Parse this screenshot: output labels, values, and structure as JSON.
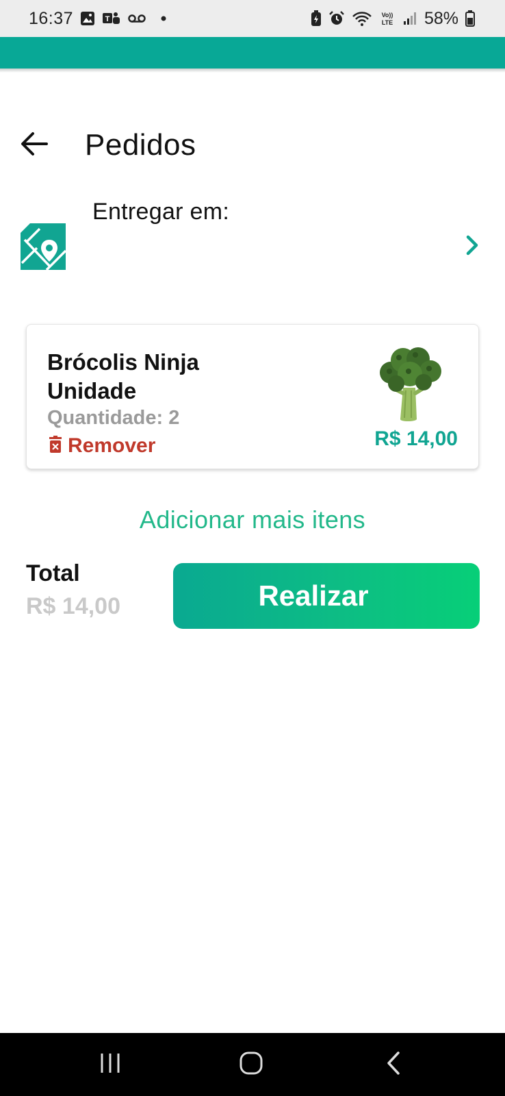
{
  "status_bar": {
    "time": "16:37",
    "battery_percent": "58%",
    "left_icons": [
      "gallery-icon",
      "teams-icon",
      "voicemail-icon",
      "dot-icon"
    ],
    "right_icons": [
      "battery-saver-icon",
      "alarm-icon",
      "wifi-icon",
      "volte-icon",
      "signal-icon",
      "battery-icon"
    ],
    "volte_text": "Vo)) LTE"
  },
  "colors": {
    "accent": "#08a896",
    "price": "#11a592",
    "remove": "#c0392b",
    "add_more": "#22b88a",
    "muted": "#9a9a9a",
    "button_gradient_start": "#0aa991",
    "button_gradient_end": "#07cf78"
  },
  "header": {
    "back_icon": "arrow-left-icon",
    "title": "Pedidos"
  },
  "delivery": {
    "icon": "map-pin-icon",
    "label": "Entregar em:",
    "chevron_icon": "chevron-right-icon"
  },
  "items": [
    {
      "name": "Brócolis Ninja Unidade",
      "quantity_text": "Quantidade: 2",
      "remove_label": "Remover",
      "remove_icon": "trash-icon",
      "price": "R$ 14,00",
      "image": "broccoli-image"
    }
  ],
  "add_more_label": "Adicionar mais itens",
  "total": {
    "label": "Total",
    "value": "R$ 14,00"
  },
  "submit_label": "Realizar",
  "nav_bar": {
    "recents_icon": "recents-icon",
    "home_icon": "home-icon",
    "back_icon": "back-icon"
  }
}
